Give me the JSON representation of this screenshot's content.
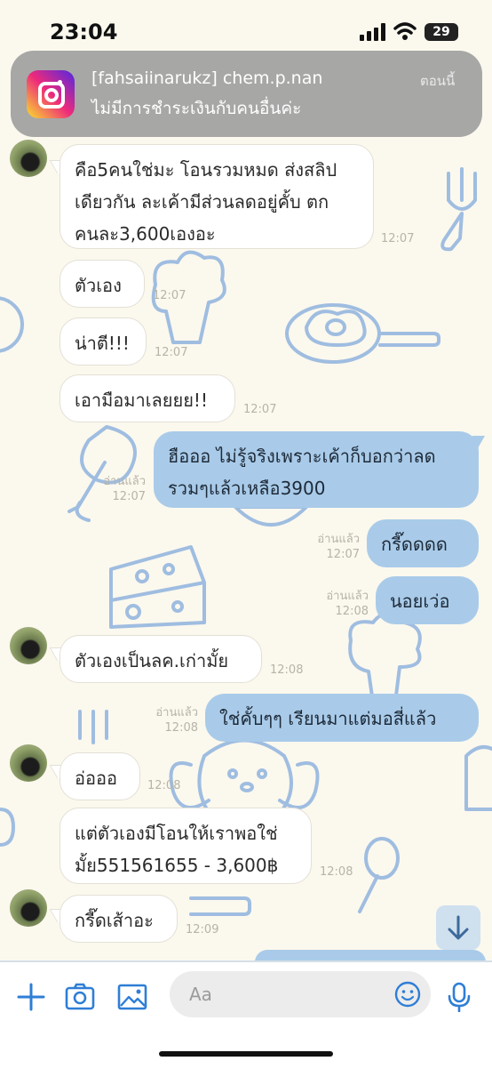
{
  "status_bar": {
    "time": "23:04",
    "battery": "29"
  },
  "notification": {
    "app_icon": "instagram-icon",
    "title": "[fahsaiinarukz] chem.p.nan",
    "body": "ไม่มีการชำระเงินกับคนอื่นค่ะ",
    "time": "ตอนนี้"
  },
  "messages": [
    {
      "side": "in",
      "lines": [
        "คือ5คนใช่มะ โอนรวมหมด ส่งสลิป",
        "เดียวกัน ละเค้ามีส่วนลดอยู่คั้บ ตก",
        "คนละ3,600เองอะ"
      ],
      "time": "12:07"
    },
    {
      "side": "in",
      "lines": [
        "ตัวเอง"
      ],
      "time": "12:07"
    },
    {
      "side": "in",
      "lines": [
        "น่าตี!!!"
      ],
      "time": "12:07"
    },
    {
      "side": "in",
      "lines": [
        "เอามือมาเลยยย!!"
      ],
      "time": "12:07"
    },
    {
      "side": "out",
      "lines": [
        "ฮือออ ไม่รู้จริงเพราะเค้าก็บอกว่าลด",
        "รวมๆแล้วเหลือ3900"
      ],
      "read": "อ่านแล้ว",
      "time": "12:07"
    },
    {
      "side": "out",
      "lines": [
        "กรี๊ดดดด"
      ],
      "read": "อ่านแล้ว",
      "time": "12:07"
    },
    {
      "side": "out",
      "lines": [
        "นอยเว่อ"
      ],
      "read": "อ่านแล้ว",
      "time": "12:08"
    },
    {
      "side": "in",
      "lines": [
        "ตัวเองเป็นลค.เก่ามั้ย"
      ],
      "time": "12:08"
    },
    {
      "side": "out",
      "lines": [
        "ใช่คั้บๆๆ เรียนมาแต่มอสี่แล้ว"
      ],
      "read": "อ่านแล้ว",
      "time": "12:08"
    },
    {
      "side": "in",
      "lines": [
        "อ่อออ"
      ],
      "time": "12:08"
    },
    {
      "side": "in",
      "lines": [
        "แต่ตัวเองมีโอนให้เราพอใช่",
        "มั้ย551561655 - 3,600฿"
      ],
      "time": "12:08"
    },
    {
      "side": "in",
      "lines": [
        "กรี๊ดเส้าอะ"
      ],
      "time": "12:09"
    }
  ],
  "input_bar": {
    "placeholder": "Aa",
    "icons": [
      "plus-icon",
      "camera-icon",
      "image-icon",
      "emoji-icon",
      "microphone-icon"
    ]
  },
  "scroll_button_icon": "arrow-down-icon",
  "colors": {
    "background": "#fbf8ee",
    "outgoing_bubble": "#a9cbe9",
    "incoming_bubble": "#ffffff",
    "doodle": "#9fbde0"
  }
}
